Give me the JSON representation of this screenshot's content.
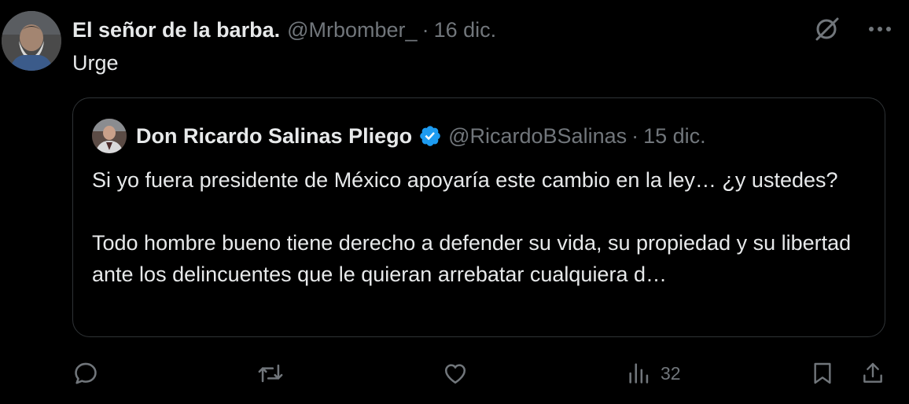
{
  "tweet": {
    "author_name": "El señor de la barba.",
    "author_handle": "@Mrbomber_",
    "separator": "·",
    "date": "16 dic.",
    "text": "Urge"
  },
  "quoted_tweet": {
    "author_name": "Don Ricardo Salinas Pliego",
    "verified": true,
    "author_handle": "@RicardoBSalinas",
    "separator": "·",
    "date": "15 dic.",
    "paragraph_1": "Si yo fuera presidente de México apoyaría este cambio en la ley… ¿y ustedes?",
    "paragraph_2": "Todo hombre bueno tiene derecho a defender su vida, su propiedad y su libertad ante los delincuentes que le quieran arrebatar cualquiera d…"
  },
  "actions": {
    "reply_icon": "reply-icon",
    "retweet_icon": "retweet-icon",
    "like_icon": "heart-icon",
    "views_icon": "views-icon",
    "views_count": "32",
    "bookmark_icon": "bookmark-icon",
    "share_icon": "share-icon"
  },
  "top_icons": [
    "grok-icon",
    "more-icon"
  ],
  "colors": {
    "background": "#000000",
    "text_primary": "#e7e9ea",
    "text_secondary": "#71767b",
    "border": "#2f3336",
    "verified_blue": "#1d9bf0"
  }
}
